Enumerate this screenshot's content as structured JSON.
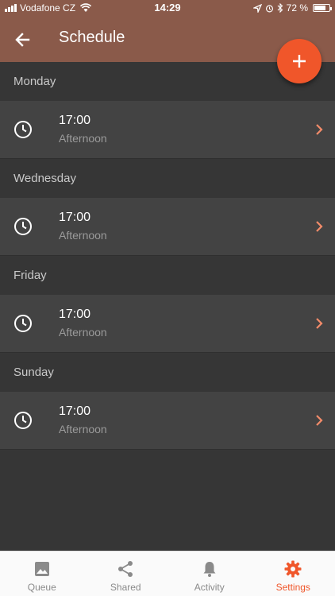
{
  "status_bar": {
    "carrier": "Vodafone CZ",
    "time": "14:29",
    "battery": "72 %",
    "battery_level": 0.72
  },
  "app_bar": {
    "title": "Schedule",
    "back_icon": "arrow-left-icon",
    "fab_icon": "plus-icon"
  },
  "schedule": [
    {
      "day": "Monday",
      "time": "17:00",
      "period": "Afternoon"
    },
    {
      "day": "Wednesday",
      "time": "17:00",
      "period": "Afternoon"
    },
    {
      "day": "Friday",
      "time": "17:00",
      "period": "Afternoon"
    },
    {
      "day": "Sunday",
      "time": "17:00",
      "period": "Afternoon"
    }
  ],
  "tabs": [
    {
      "label": "Queue",
      "icon": "image-icon",
      "active": false
    },
    {
      "label": "Shared",
      "icon": "share-icon",
      "active": false
    },
    {
      "label": "Activity",
      "icon": "bell-icon",
      "active": false
    },
    {
      "label": "Settings",
      "icon": "gear-icon",
      "active": true
    }
  ],
  "colors": {
    "header_bg": "#8a5a4a",
    "accent": "#f0562a",
    "background": "#363636",
    "row_bg": "#434343"
  }
}
